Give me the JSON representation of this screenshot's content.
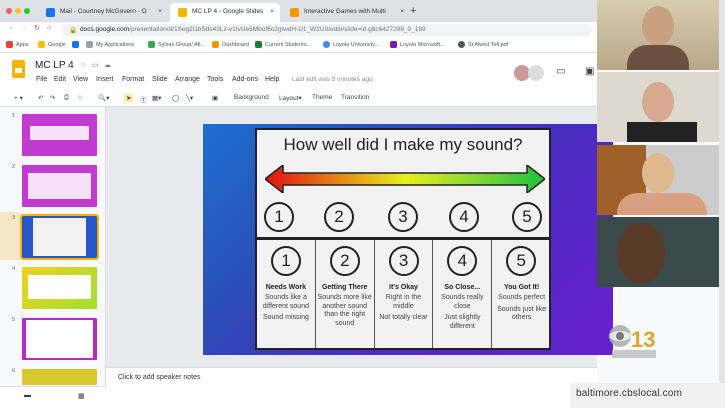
{
  "browser": {
    "tabs": [
      {
        "label": "Mail - Courtney McGovern - O",
        "color": "#1a73e8"
      },
      {
        "label": "MC LP 4 - Google Slides",
        "color": "#f4b400",
        "active": true
      },
      {
        "label": "Interactive Games with Multi",
        "color": "#f29900"
      }
    ],
    "new_tab": "+",
    "url_domain": "docs.google.com",
    "url_path": "/presentation/d/1Seg2i1bSds43Li/-v1IvUe6Mbof6oJgIwdH-U1_W2U0/edit#slide=id.g8c6427288_0_189",
    "bookmarks": [
      {
        "label": "Apps",
        "color": "#ea4335"
      },
      {
        "label": "Google",
        "color": "#fbbc05"
      },
      {
        "label": "",
        "color": "#1a73e8"
      },
      {
        "label": "My Applications",
        "color": "#9aa0a6"
      },
      {
        "label": "Sylvan Group/ Atl...",
        "color": "#34a853"
      },
      {
        "label": "Dashboard",
        "color": "#f29900"
      },
      {
        "label": "Current Students...",
        "color": "#188038"
      },
      {
        "label": "Loyola University...",
        "color": "#4285f4"
      },
      {
        "label": "Loyola Microsoft...",
        "color": "#7b1fa2"
      },
      {
        "label": "St Alwed Tell.pdf",
        "color": "#555555"
      }
    ]
  },
  "slides_app": {
    "title": "MC LP 4",
    "menus": [
      "File",
      "Edit",
      "View",
      "Insert",
      "Format",
      "Slide",
      "Arrange",
      "Tools",
      "Add-ons",
      "Help"
    ],
    "last_edit": "Last edit was 5 minutes ago",
    "toolbar": [
      "Background",
      "Layout▾",
      "Theme",
      "Transition"
    ],
    "thumbnails": [
      {
        "n": "1",
        "color": "#c23bd0"
      },
      {
        "n": "2",
        "color": "#c23bd0"
      },
      {
        "n": "3",
        "color": "#2855c8",
        "selected": true
      },
      {
        "n": "4",
        "color": "#c8d830"
      },
      {
        "n": "5",
        "color": "#b02ec0"
      },
      {
        "n": "6",
        "color": "#d8c830"
      }
    ],
    "speaker_notes": "Click to add speaker notes"
  },
  "slide": {
    "question": "How well did I make my sound?",
    "scale": [
      "1",
      "2",
      "3",
      "4",
      "5"
    ],
    "columns": [
      {
        "n": "1",
        "heading": "Needs Work",
        "lines": [
          "Sounds like a different sound",
          "Sound missing"
        ]
      },
      {
        "n": "2",
        "heading": "Getting There",
        "lines": [
          "Sounds more like another sound than the right sound"
        ]
      },
      {
        "n": "3",
        "heading": "It's Okay",
        "lines": [
          "Right in the middle",
          "Not totally clear"
        ]
      },
      {
        "n": "4",
        "heading": "So Close...",
        "lines": [
          "Sounds really close",
          "Just slightly different"
        ]
      },
      {
        "n": "5",
        "heading": "You Got It!",
        "lines": [
          "Sounds perfect",
          "Sounds just like others"
        ]
      }
    ]
  },
  "broadcast": {
    "watermark": "baltimore.cbslocal.com",
    "logo": "CBS 13 WJZ"
  }
}
